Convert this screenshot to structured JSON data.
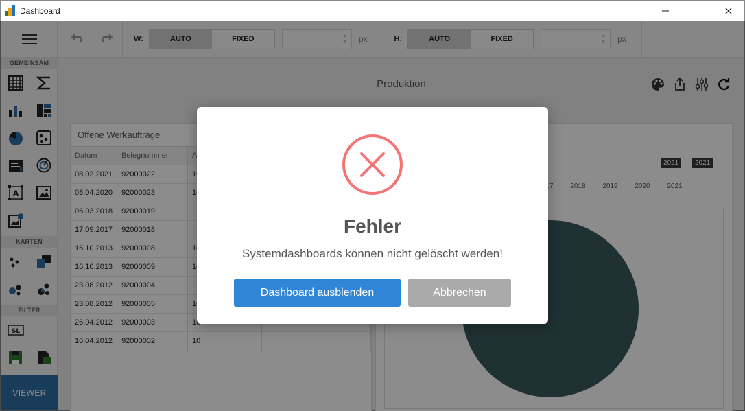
{
  "window": {
    "title": "Dashboard"
  },
  "sidebar": {
    "sections": [
      "GEMEINSAM",
      "KARTEN",
      "FILTER"
    ],
    "viewer_label": "VIEWER"
  },
  "toolbar": {
    "width": {
      "label": "W:",
      "auto": "AUTO",
      "fixed": "FIXED",
      "unit": "px"
    },
    "height": {
      "label": "H:",
      "auto": "AUTO",
      "fixed": "FIXED",
      "unit": "px"
    }
  },
  "dashboard": {
    "title": "Produktion",
    "table_panel": {
      "title": "Offene Werkaufträge",
      "columns": [
        "Datum",
        "Belegnummer",
        "A"
      ],
      "rows": [
        [
          "08.02.2021",
          "92000022",
          "10"
        ],
        [
          "08.04.2020",
          "92000023",
          "10"
        ],
        [
          "06.03.2018",
          "92000019",
          ""
        ],
        [
          "17.09.2017",
          "92000018",
          ""
        ],
        [
          "16.10.2013",
          "92000008",
          "10"
        ],
        [
          "16.10.2013",
          "92000009",
          "10"
        ],
        [
          "23.08.2012",
          "92000004",
          ""
        ],
        [
          "23.08.2012",
          "92000005",
          "10"
        ],
        [
          "26.04.2012",
          "92000003",
          "10"
        ],
        [
          "16.04.2012",
          "92000002",
          "10"
        ]
      ]
    },
    "chart_panel": {
      "years": [
        "2017",
        "2018",
        "2019",
        "2020",
        "2021"
      ],
      "range_tags": [
        "2021",
        "2021"
      ],
      "pie_color": "#3a5a5e"
    }
  },
  "dialog": {
    "title": "Fehler",
    "message": "Systemdashboards können nicht gelöscht werden!",
    "primary_button": "Dashboard ausblenden",
    "secondary_button": "Abbrechen",
    "icon_color": "#f27474"
  }
}
